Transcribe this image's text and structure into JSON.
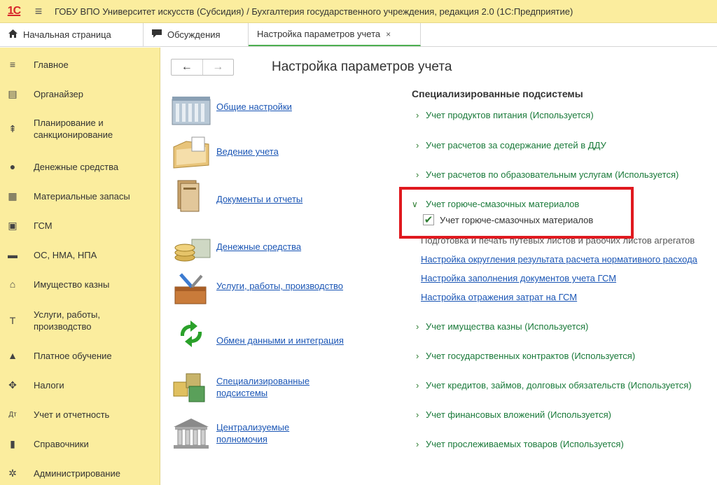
{
  "titlebar": {
    "logo": "1С",
    "title": "ГОБУ ВПО Университет искусств (Субсидия) / Бухгалтерия государственного учреждения, редакция 2.0  (1С:Предприятие)"
  },
  "tabs": [
    {
      "label": "Начальная страница",
      "icon": "home-icon"
    },
    {
      "label": "Обсуждения",
      "icon": "chat-icon"
    },
    {
      "label": "Настройка параметров учета",
      "close": "×"
    }
  ],
  "sidebar": {
    "items": [
      {
        "label": "Главное",
        "icon": "menu-icon",
        "glyph": "≡"
      },
      {
        "label": "Органайзер",
        "icon": "organizer-icon",
        "glyph": "▤"
      },
      {
        "label": "Планирование и санкционирование",
        "icon": "planning-icon",
        "glyph": "⇞"
      },
      {
        "label": "Денежные средства",
        "icon": "money-icon",
        "glyph": "●"
      },
      {
        "label": "Материальные запасы",
        "icon": "inventory-icon",
        "glyph": "▦"
      },
      {
        "label": "ГСМ",
        "icon": "fuel-icon",
        "glyph": "▣"
      },
      {
        "label": "ОС, НМА, НПА",
        "icon": "truck-icon",
        "glyph": "▬"
      },
      {
        "label": "Имущество казны",
        "icon": "treasury-icon",
        "glyph": "⌂"
      },
      {
        "label": "Услуги, работы, производство",
        "icon": "services-icon",
        "glyph": "T"
      },
      {
        "label": "Платное обучение",
        "icon": "graduation-icon",
        "glyph": "▲"
      },
      {
        "label": "Налоги",
        "icon": "emblem-icon",
        "glyph": "✥"
      },
      {
        "label": "Учет и отчетность",
        "icon": "accounting-icon",
        "glyph": "Дт"
      },
      {
        "label": "Справочники",
        "icon": "reference-icon",
        "glyph": "▮"
      },
      {
        "label": "Администрирование",
        "icon": "gear-icon",
        "glyph": "✲"
      }
    ]
  },
  "main": {
    "back": "←",
    "forward": "→",
    "title": "Настройка параметров учета",
    "nav": [
      {
        "label": "Общие настройки"
      },
      {
        "label": "Ведение учета"
      },
      {
        "label": "Документы и отчеты"
      },
      {
        "label": "Денежные средства"
      },
      {
        "label": "Услуги, работы, производство"
      },
      {
        "label": "Обмен данными и интеграция"
      },
      {
        "label": "Специализированные подсистемы"
      },
      {
        "label": "Централизуемые полномочия"
      }
    ],
    "subsystems_title": "Специализированные подсистемы",
    "rows_top": [
      "Учет продуктов питания (Используется)",
      "Учет расчетов за содержание детей в ДДУ",
      "Учет расчетов по образовательным услугам (Используется)"
    ],
    "gsm_group": "Учет горюче-смазочных материалов",
    "gsm_checkbox": "Учет горюче-смазочных материалов",
    "gsm_checked": true,
    "gsm_description": "Подготовка и печать путевых листов и рабочих листов агрегатов",
    "gsm_links": [
      "Настройка округления результата расчета нормативного расхода",
      "Настройка заполнения документов учета ГСМ",
      "Настройка отражения затрат на ГСМ"
    ],
    "rows_bottom": [
      "Учет имущества казны (Используется)",
      "Учет государственных контрактов (Используется)",
      "Учет кредитов, займов, долговых обязательств (Используется)",
      "Учет финансовых вложений (Используется)",
      "Учет прослеживаемых товаров (Используется)"
    ],
    "check_glyph": "✔",
    "chevron": "›",
    "chevron_open": "∨"
  }
}
